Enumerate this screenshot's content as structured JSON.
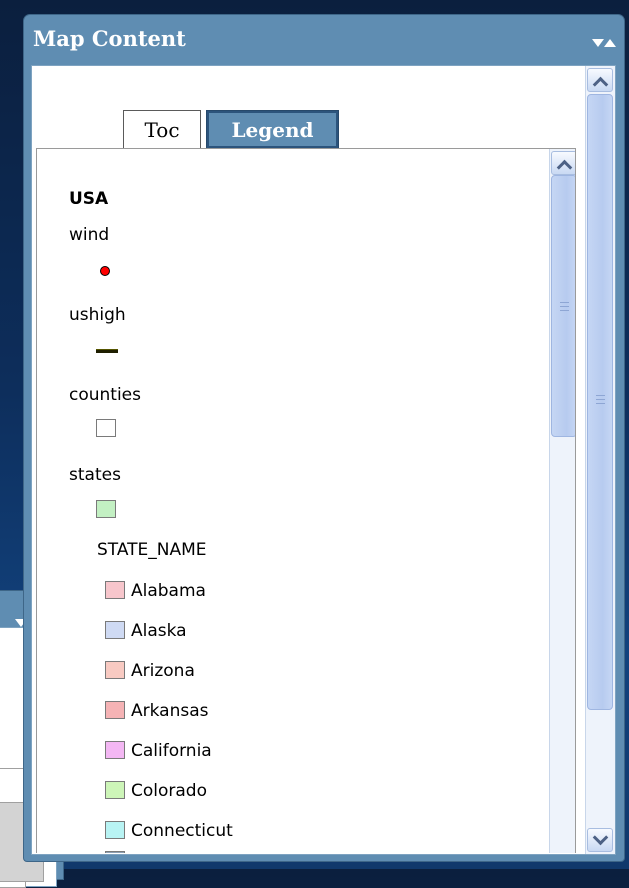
{
  "window": {
    "title": "Map Content",
    "collapse_icon": "collapse-expand-arrows-icon"
  },
  "tabs": [
    {
      "label": "Toc",
      "active": false
    },
    {
      "label": "Legend",
      "active": true
    }
  ],
  "legend": {
    "service": "USA",
    "layers": [
      {
        "name": "wind",
        "symbol": "red-dot",
        "color": "#ff0000"
      },
      {
        "name": "ushigh",
        "symbol": "line",
        "color": "#1e1e00"
      },
      {
        "name": "counties",
        "symbol": "box",
        "color": "#ffffff"
      },
      {
        "name": "states",
        "symbol": "box",
        "color": "#c3f0c3"
      }
    ],
    "field_label": "STATE_NAME",
    "states": [
      {
        "name": "Alabama",
        "color": "#f7c6cc"
      },
      {
        "name": "Alaska",
        "color": "#cfdaf3"
      },
      {
        "name": "Arizona",
        "color": "#f8cac2"
      },
      {
        "name": "Arkansas",
        "color": "#f5b3b5"
      },
      {
        "name": "California",
        "color": "#f3b7f3"
      },
      {
        "name": "Colorado",
        "color": "#cdf5b8"
      },
      {
        "name": "Connecticut",
        "color": "#b8f3f3"
      },
      {
        "name": "",
        "color": "#8fa1b5"
      }
    ]
  },
  "colors": {
    "title_bar": "#5f8db2",
    "background": "#0d2e5c",
    "scrollbar": "#c5d6f4"
  }
}
